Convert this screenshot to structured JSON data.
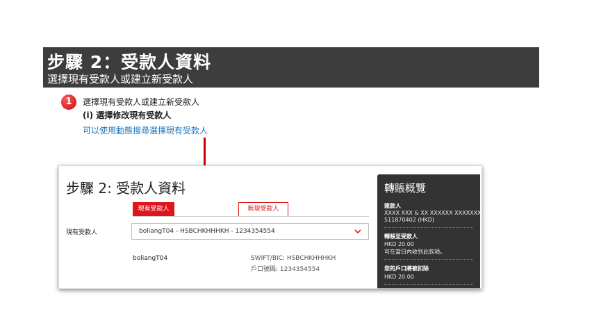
{
  "header": {
    "title": "步驟 2：受款人資料",
    "subtitle": "選擇現有受款人或建立新受款人"
  },
  "step": {
    "number": "1",
    "line1": "選擇現有受款人或建立新受款人",
    "line2": "(i) 選擇修改現有受款人",
    "line3": "可以使用動態搜尋選擇現有受款人"
  },
  "form": {
    "title": "步驟 2: 受款人資料",
    "tab_existing": "現有受款人",
    "tab_new": "新增受款人",
    "field_label": "現有受款人",
    "select_value": "boliangT04 - HSBCHKHHHKH - 1234354554",
    "payee_name": "boliangT04",
    "swift": "SWIFT/BIC: HSBCHKHHHKH",
    "account": "戶口號碼: 1234354554"
  },
  "summary": {
    "title": "轉賬概覽",
    "from_label": "匯款人",
    "from_line1": "XXXX XXX & XX XXXXXX XXXXXXX",
    "from_line2": "511870402 (HKD)",
    "to_label": "轉賬至受款人",
    "to_amount": "HKD 20.00",
    "to_note": "可在當日內收到此款項。",
    "debit_label": "您的戶口將被扣除",
    "debit_amount": "HKD 20.00"
  },
  "colors": {
    "accent_red": "#e0151b",
    "header_bg": "#3d3d3d",
    "link_blue": "#1b75bb",
    "summary_bg": "#333333"
  }
}
